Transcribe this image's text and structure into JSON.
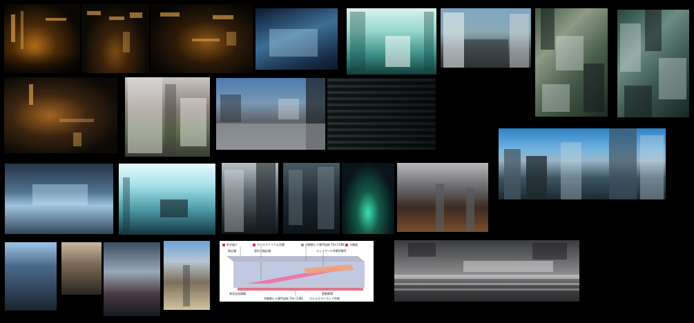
{
  "board": {
    "background": "#000000"
  },
  "diagram": {
    "labels": [
      "吹き抜け",
      "ホテルアトリウム空間",
      "京都駅ビル専門店街 The CUBE",
      "ジェイアール京都伊勢丹",
      "室町小路広場",
      "東広場",
      "大階段",
      "南北自由通路",
      "京都劇場",
      "京都駅ビル専門店街 The CUBE",
      "ホテルグランヴィア京都"
    ],
    "accent_colors": [
      "#d6365a",
      "#e87aa4",
      "#8e9ac9",
      "#f0a27a",
      "#b9b9d2"
    ]
  }
}
